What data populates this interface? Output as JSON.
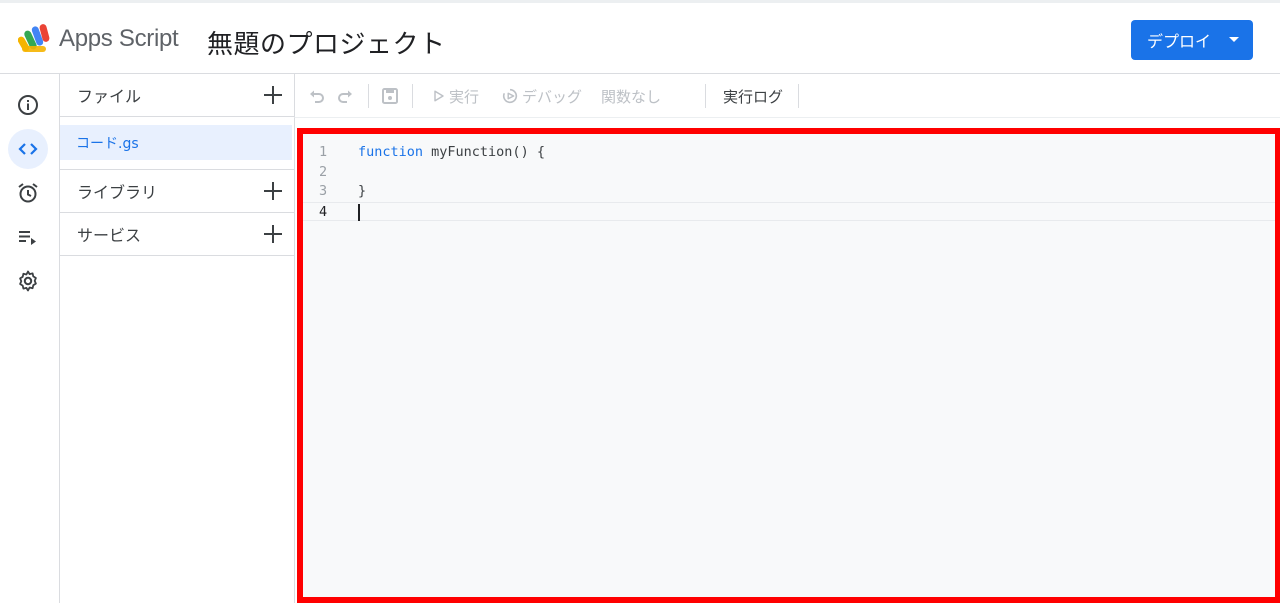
{
  "header": {
    "app_name": "Apps Script",
    "project_title": "無題のプロジェクト",
    "deploy_label": "デプロイ"
  },
  "rail": {
    "items": [
      {
        "name": "overview",
        "icon": "info-icon",
        "active": false
      },
      {
        "name": "editor",
        "icon": "code-icon",
        "active": true
      },
      {
        "name": "triggers",
        "icon": "alarm-clock-icon",
        "active": false
      },
      {
        "name": "executions",
        "icon": "playlist-play-icon",
        "active": false
      },
      {
        "name": "settings",
        "icon": "gear-icon",
        "active": false
      }
    ]
  },
  "files_panel": {
    "files_header": "ファイル",
    "files": [
      {
        "name": "コード.gs",
        "selected": true
      }
    ],
    "libraries_header": "ライブラリ",
    "services_header": "サービス"
  },
  "toolbar": {
    "undo_icon": "undo-icon",
    "redo_icon": "redo-icon",
    "save_icon": "save-icon",
    "run_label": "実行",
    "debug_label": "デバッグ",
    "function_select": "関数なし",
    "exec_log_label": "実行ログ"
  },
  "editor": {
    "lines": [
      {
        "number": "1",
        "keyword": "function",
        "rest": " myFunction() {"
      },
      {
        "number": "2",
        "keyword": "",
        "rest": ""
      },
      {
        "number": "3",
        "keyword": "",
        "rest": "}"
      },
      {
        "number": "4",
        "keyword": "",
        "rest": ""
      }
    ],
    "current_line": "4"
  },
  "colors": {
    "accent": "#1a73e8",
    "highlight_border": "#ff0000",
    "editor_bg": "#f8f9fa",
    "selected_bg": "#e8f0fe"
  }
}
